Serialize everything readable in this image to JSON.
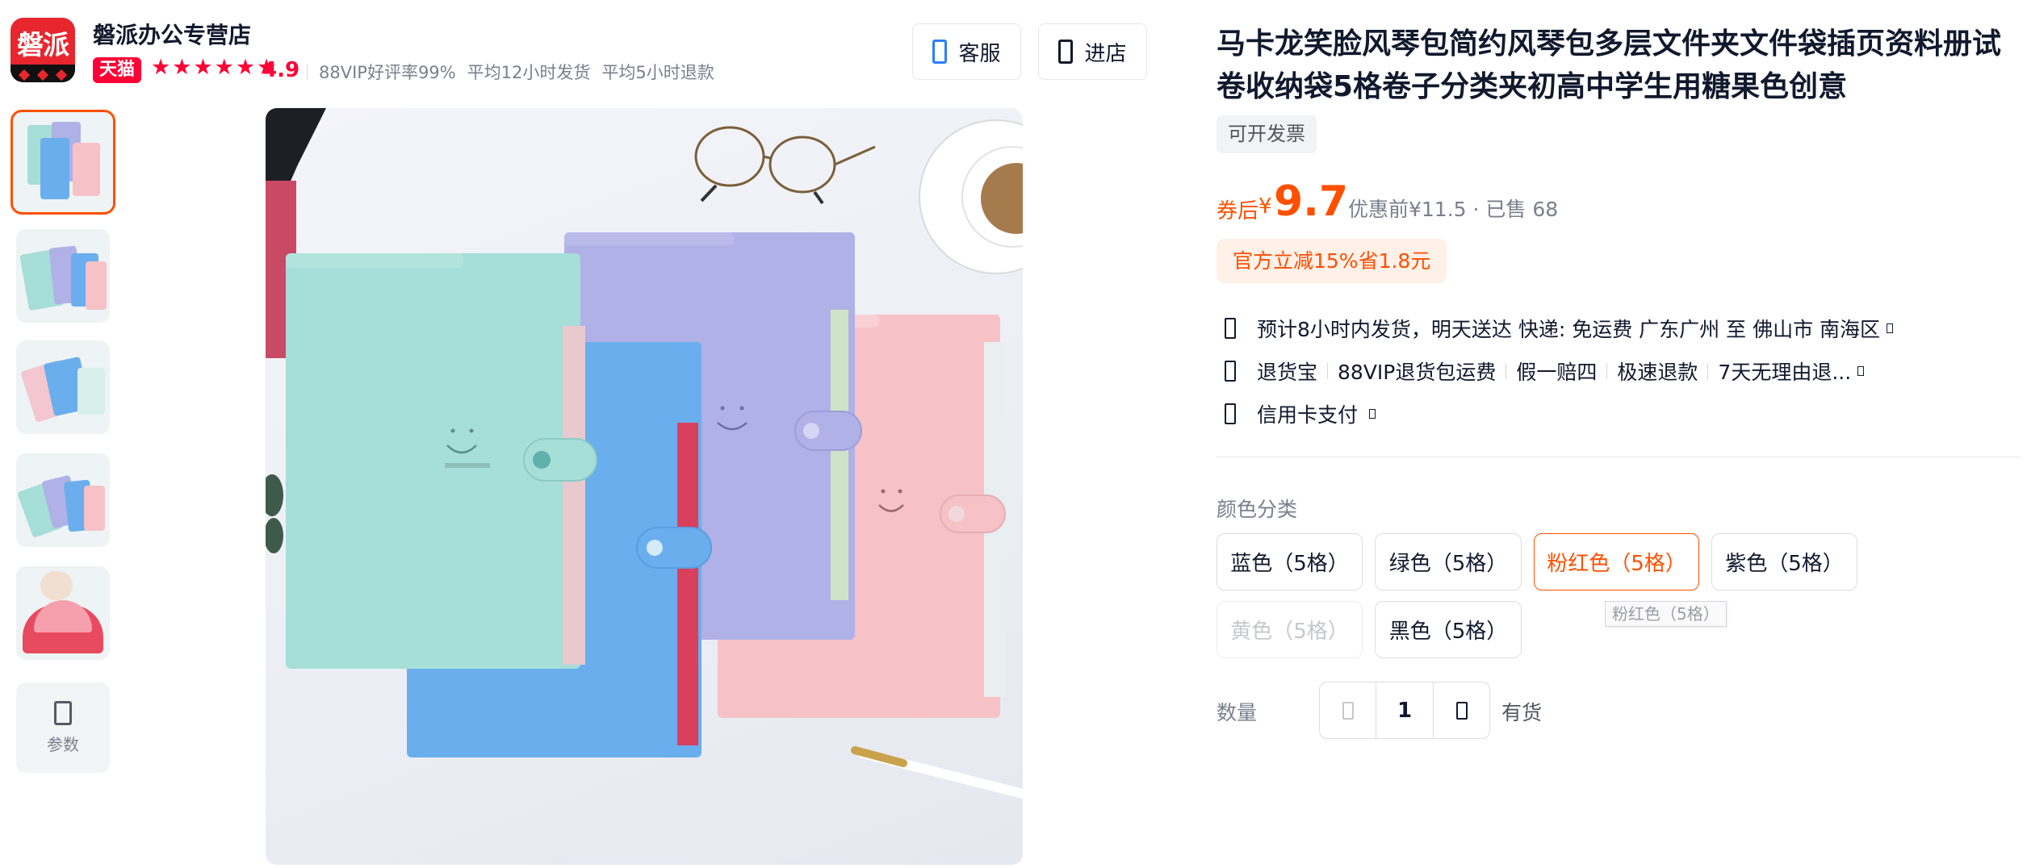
{
  "shop": {
    "logo_text": "磐派",
    "name": "磐派办公专营店",
    "badge": "天猫",
    "stars": "★★★★★★",
    "rating": "4.9",
    "stats": [
      "88VIP好评率99%",
      "平均12小时发货",
      "平均5小时退款"
    ]
  },
  "actions": {
    "service_label": "客服",
    "enter_label": "进店"
  },
  "gallery": {
    "param_label": "参数"
  },
  "product": {
    "title": "马卡龙笑脸风琴包简约风琴包多层文件夹文件袋插页资料册试卷收纳袋5格卷子分类夹初高中学生用糖果色创意",
    "invoice_tag": "可开发票",
    "price_prefix": "券后",
    "price_symbol": "¥",
    "price": "9.7",
    "orig_price_text": "优惠前¥11.5 · 已售 68",
    "promo": "官方立减15%省1.8元"
  },
  "services": [
    {
      "items": [
        "预计8小时内发货，明天送达  快递: 免运费  广东广州 至 佛山市 南海区"
      ]
    },
    {
      "items": [
        "退货宝",
        "88VIP退货包运费",
        "假一赔四",
        "极速退款",
        "7天无理由退..."
      ]
    },
    {
      "items": [
        "信用卡支付"
      ]
    }
  ],
  "sku": {
    "label": "颜色分类",
    "options": [
      "蓝色（5格）",
      "绿色（5格）",
      "粉红色（5格）",
      "紫色（5格）",
      "黄色（5格）",
      "黑色（5格）"
    ],
    "selected": "粉红色（5格）",
    "disabled": "黄色（5格）",
    "tooltip": "粉红色（5格）"
  },
  "quantity": {
    "label": "数量",
    "value": "1",
    "stock": "有货"
  },
  "colors": {
    "accent": "#ff5000",
    "tmall_red": "#ff0036",
    "folder_mint": "#a6ded8",
    "folder_blue": "#6aaeee",
    "folder_purple": "#b0b1e6",
    "folder_pink": "#f6c2c6"
  }
}
